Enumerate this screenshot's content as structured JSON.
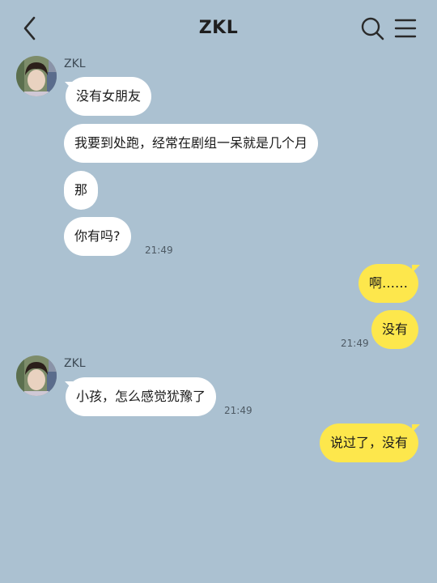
{
  "header": {
    "title": "ZKL",
    "back_icon": "chevron-left-icon",
    "search_icon": "search-icon",
    "menu_icon": "menu-icon"
  },
  "colors": {
    "background": "#abc1d1",
    "incoming_bubble": "#ffffff",
    "outgoing_bubble": "#fde74c"
  },
  "messages": {
    "group1": {
      "sender": "ZKL",
      "m1": "没有女朋友",
      "m2": "我要到处跑，经常在剧组一呆就是几个月",
      "m3": "那",
      "m4": "你有吗?",
      "time": "21:49"
    },
    "group2": {
      "m1": "啊……",
      "m2": "没有",
      "time": "21:49"
    },
    "group3": {
      "sender": "ZKL",
      "m1": "小孩，怎么感觉犹豫了",
      "time": "21:49"
    },
    "group4": {
      "m1": "说过了，没有"
    }
  }
}
